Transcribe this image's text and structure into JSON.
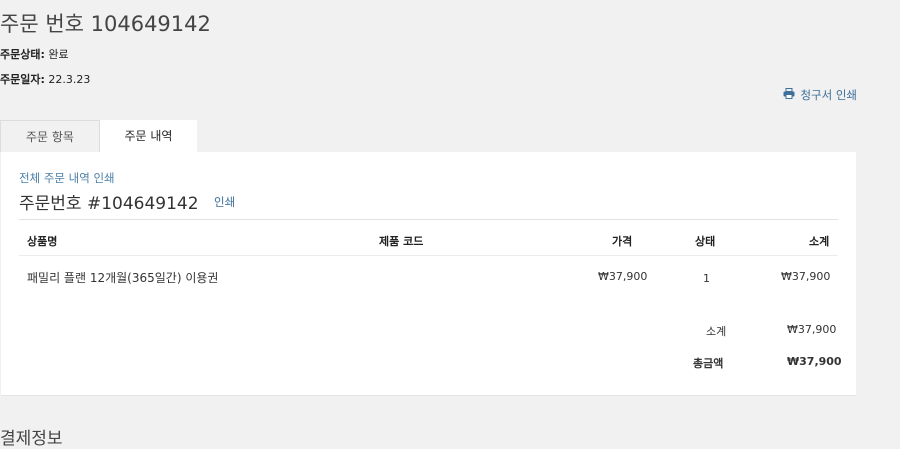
{
  "order": {
    "title": "주문 번호 104649142",
    "status_label": "주문상태:",
    "status_value": "완료",
    "date_label": "주문일자:",
    "date_value": "22.3.23",
    "invoice_print": "청구서 인쇄"
  },
  "tabs": [
    {
      "label": "주문 항목",
      "active": false
    },
    {
      "label": "주문 내역",
      "active": true
    }
  ],
  "panel": {
    "print_all": "전체 주문 내역 인쇄",
    "heading": "주문번호 #104649142",
    "print": "인쇄",
    "columns": [
      "상품명",
      "제품 코드",
      "가격",
      "상태",
      "소계"
    ],
    "rows": [
      {
        "name": "패밀리 플랜 12개월(365일간) 이용권",
        "code": "",
        "price": "₩37,900",
        "qty": "1",
        "subtotal": "₩37,900"
      }
    ],
    "summary": {
      "subtotal_label": "소계",
      "subtotal_value": "₩37,900",
      "total_label": "총금액",
      "total_value": "₩37,900"
    }
  },
  "payment_heading": "결제정보",
  "icons": {
    "printer": "printer-icon"
  },
  "colors": {
    "link": "#3d6f9a",
    "background": "#f1f1f1",
    "panel": "#ffffff"
  }
}
